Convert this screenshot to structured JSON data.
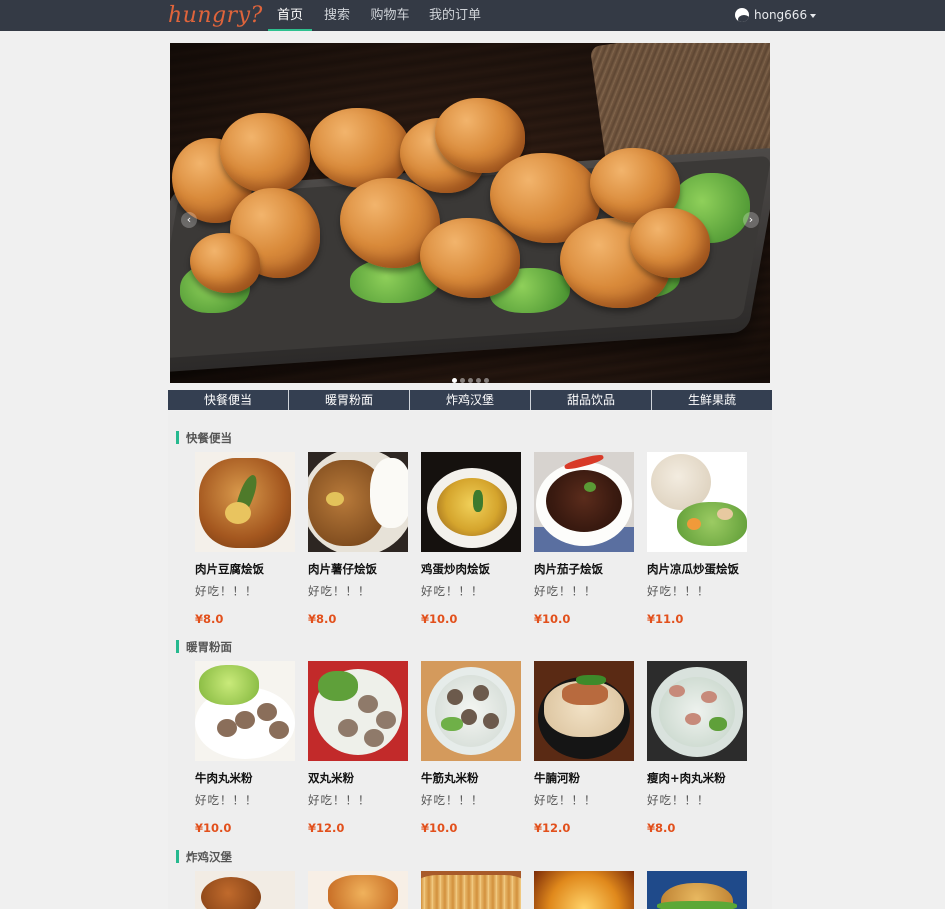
{
  "brand": {
    "logo_text": "hungry?"
  },
  "nav": {
    "items": [
      {
        "label": "首页",
        "active": true
      },
      {
        "label": "搜索",
        "active": false
      },
      {
        "label": "购物车",
        "active": false
      },
      {
        "label": "我的订单",
        "active": false
      }
    ],
    "user": "hong666"
  },
  "carousel": {
    "slide_count": 5,
    "active_index": 0,
    "prev_icon": "chevron-left-icon",
    "next_icon": "chevron-right-icon"
  },
  "categories": [
    "快餐便当",
    "暖胃粉面",
    "炸鸡汉堡",
    "甜品饮品",
    "生鲜果蔬"
  ],
  "sections": [
    {
      "title": "快餐便当",
      "items": [
        {
          "name": "肉片豆腐烩饭",
          "desc": "好吃！！！",
          "price": "¥8.0"
        },
        {
          "name": "肉片薯仔烩饭",
          "desc": "好吃！！！",
          "price": "¥8.0"
        },
        {
          "name": "鸡蛋炒肉烩饭",
          "desc": "好吃！！！",
          "price": "¥10.0"
        },
        {
          "name": "肉片茄子烩饭",
          "desc": "好吃！！！",
          "price": "¥10.0"
        },
        {
          "name": "肉片凉瓜炒蛋烩饭",
          "desc": "好吃！！！",
          "price": "¥11.0"
        }
      ]
    },
    {
      "title": "暖胃粉面",
      "items": [
        {
          "name": "牛肉丸米粉",
          "desc": "好吃！！！",
          "price": "¥10.0"
        },
        {
          "name": "双丸米粉",
          "desc": "好吃！！！",
          "price": "¥12.0"
        },
        {
          "name": "牛筋丸米粉",
          "desc": "好吃！！！",
          "price": "¥10.0"
        },
        {
          "name": "牛腩河粉",
          "desc": "好吃！！！",
          "price": "¥12.0"
        },
        {
          "name": "瘦肉+肉丸米粉",
          "desc": "好吃！！！",
          "price": "¥8.0"
        }
      ]
    },
    {
      "title": "炸鸡汉堡",
      "items": []
    }
  ],
  "colors": {
    "navbar": "#343a45",
    "accent": "#2fc08f",
    "price": "#e2501c",
    "tab": "#343f51"
  }
}
